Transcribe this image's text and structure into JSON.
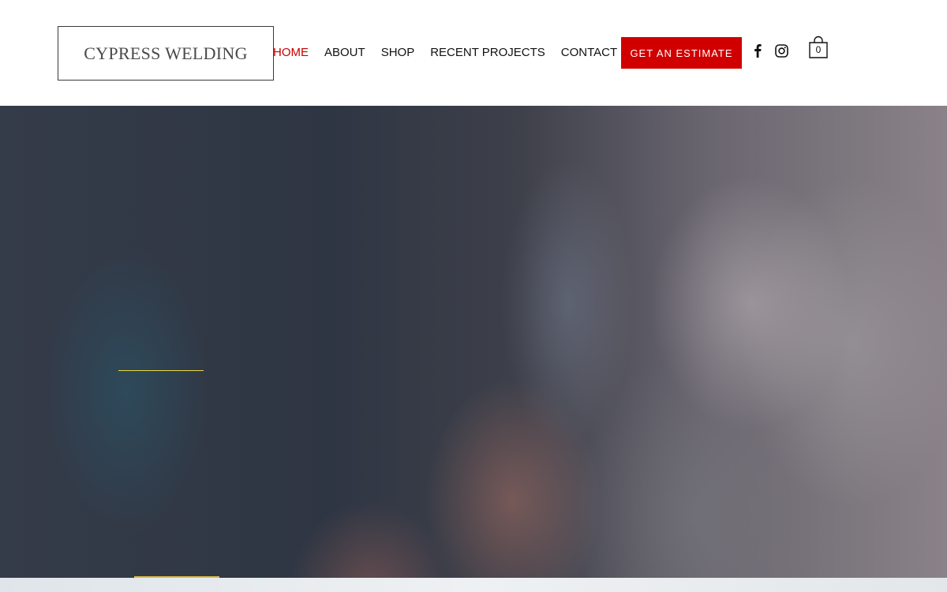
{
  "brand": {
    "name": "CYPRESS WELDING"
  },
  "nav": {
    "items": [
      {
        "label": "HOME",
        "active": true
      },
      {
        "label": "ABOUT",
        "active": false
      },
      {
        "label": "SHOP",
        "active": false
      },
      {
        "label": "RECENT PROJECTS",
        "active": false
      },
      {
        "label": "CONTACT",
        "active": false
      }
    ]
  },
  "cta": {
    "label": "GET AN ESTIMATE"
  },
  "social": {
    "icons": [
      "facebook-icon",
      "instagram-icon"
    ]
  },
  "cart": {
    "count": "0",
    "icon": "shopping-bag-icon"
  },
  "colors": {
    "accent": "#d10000",
    "active_nav": "#c80000",
    "hero_line": "#e9d84a"
  }
}
